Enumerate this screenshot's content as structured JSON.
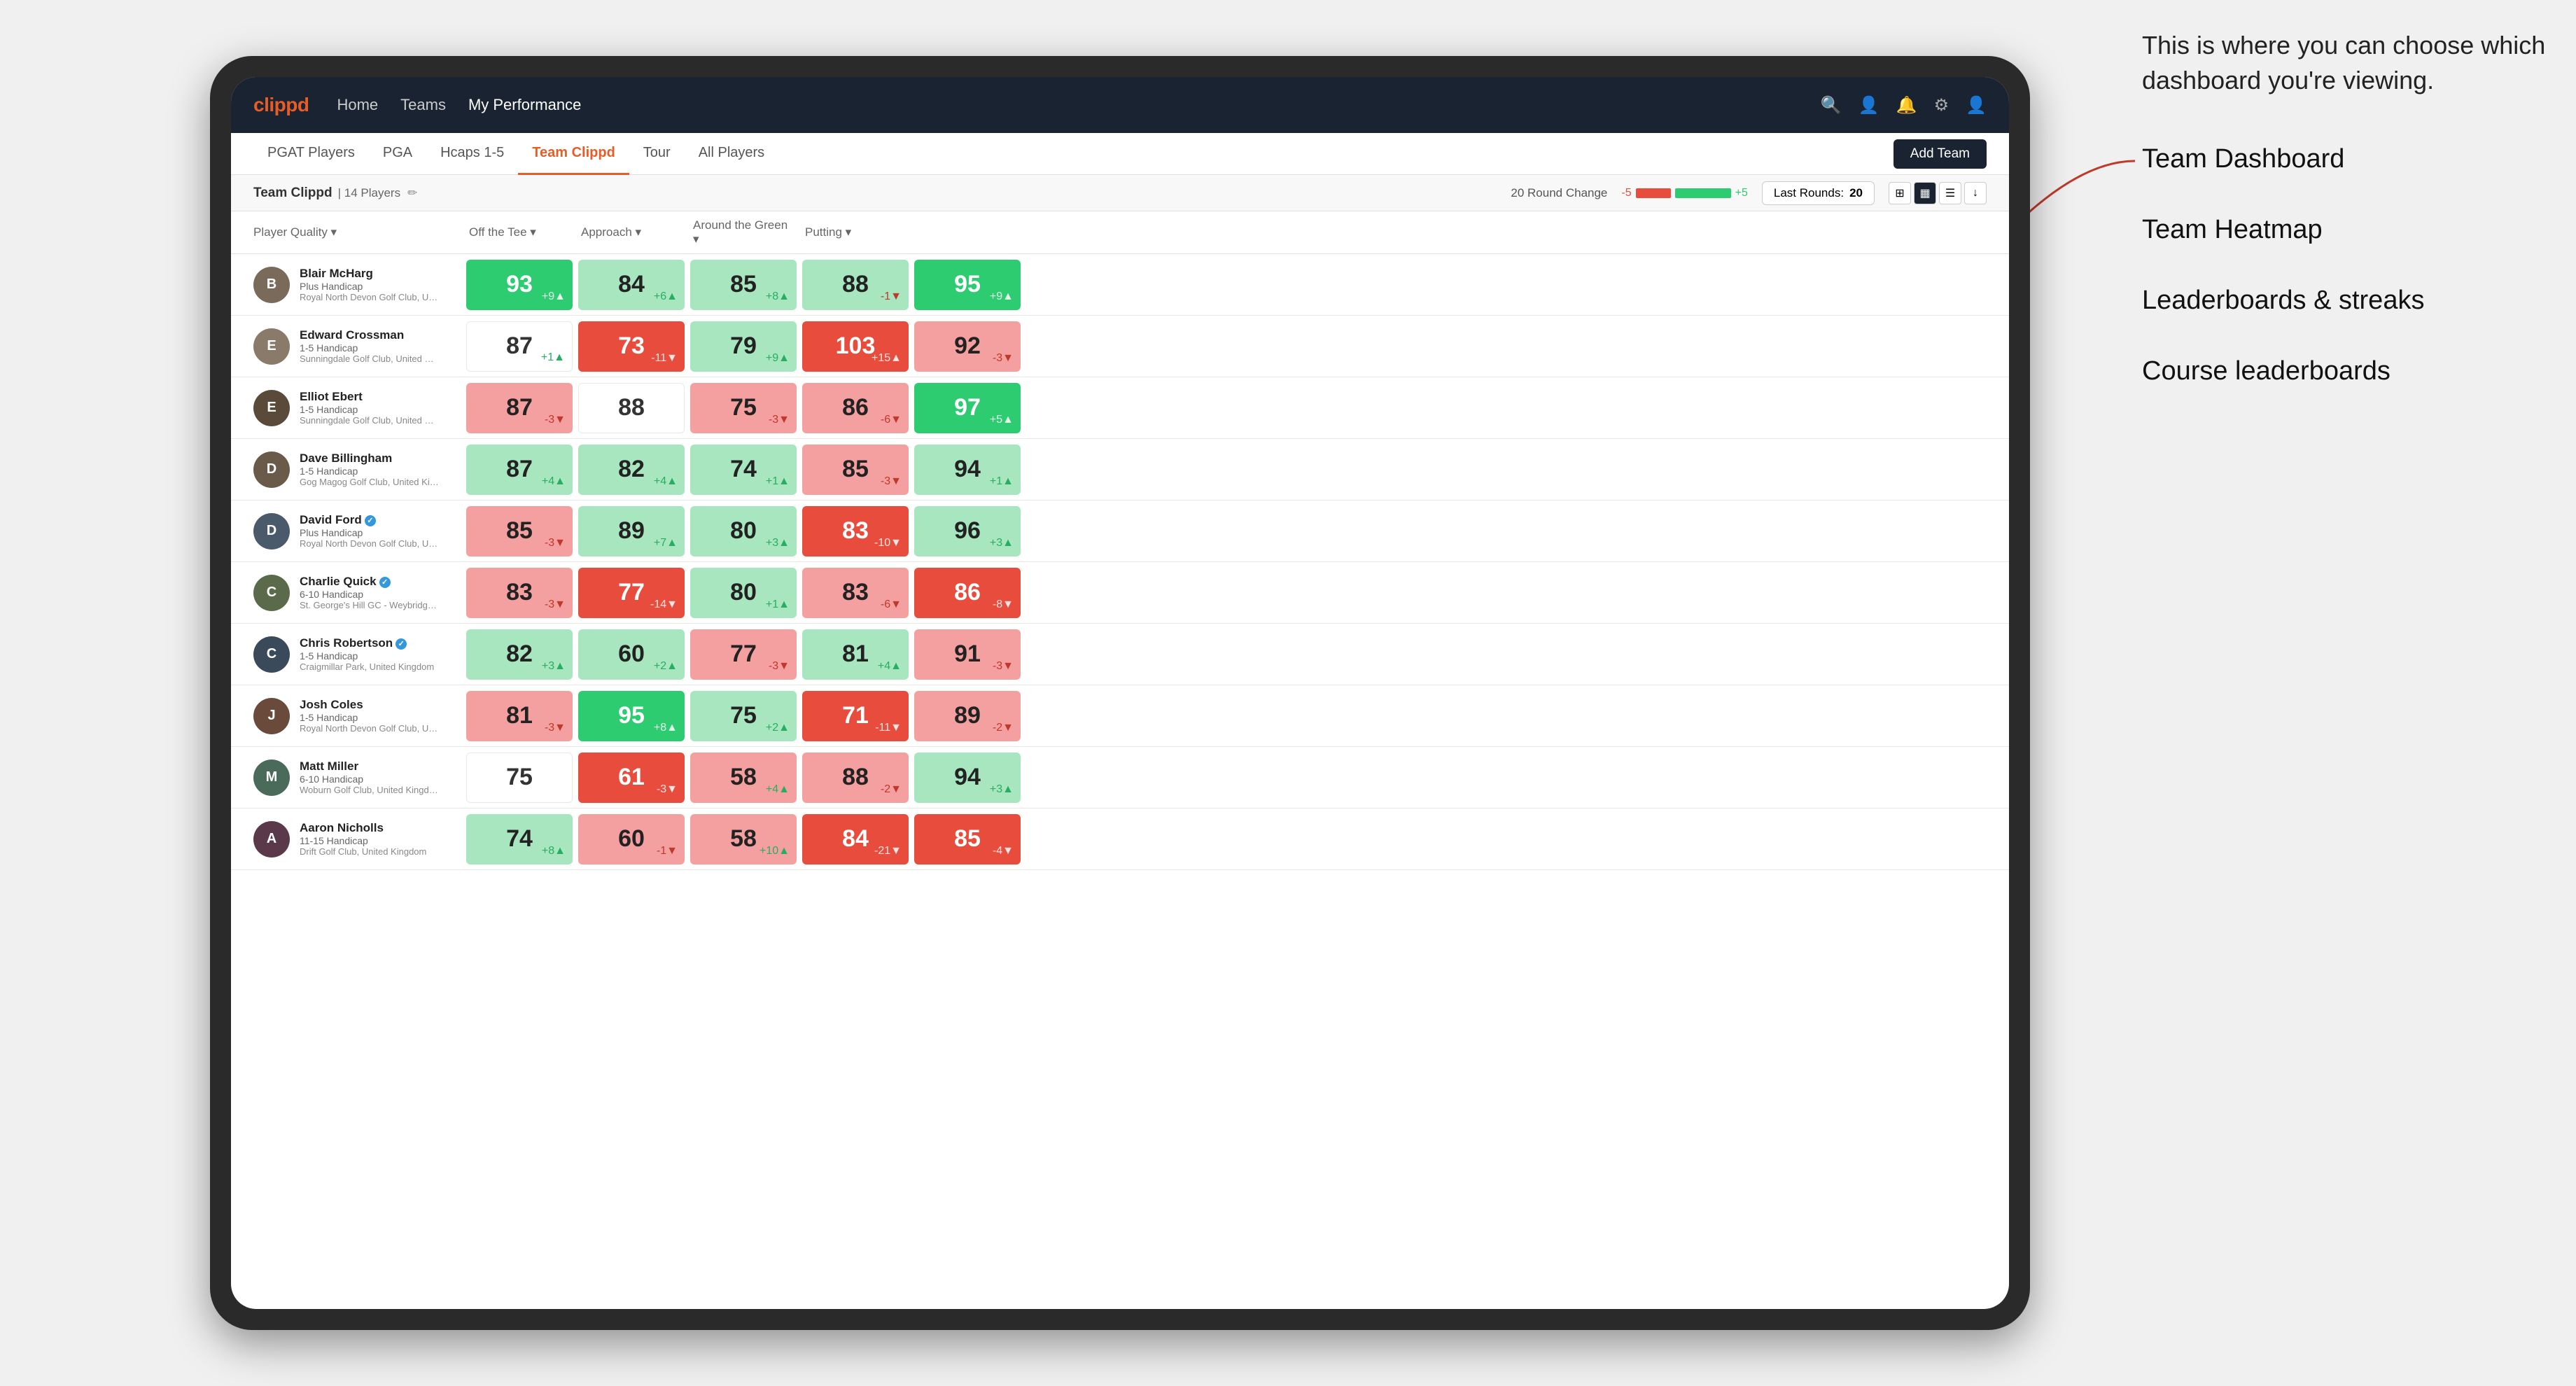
{
  "annotation": {
    "intro": "This is where you can choose which dashboard you're viewing.",
    "items": [
      "Team Dashboard",
      "Team Heatmap",
      "Leaderboards & streaks",
      "Course leaderboards"
    ]
  },
  "nav": {
    "logo": "clippd",
    "items": [
      "Home",
      "Teams",
      "My Performance"
    ],
    "active": "My Performance",
    "icons": [
      "🔍",
      "👤",
      "🔔",
      "⚙",
      "👤"
    ]
  },
  "sub_nav": {
    "items": [
      "PGAT Players",
      "PGA",
      "Hcaps 1-5",
      "Team Clippd",
      "Tour",
      "All Players"
    ],
    "active": "Team Clippd",
    "add_team_label": "Add Team"
  },
  "team_header": {
    "name": "Team Clippd",
    "separator": "|",
    "count": "14 Players",
    "round_change_label": "20 Round Change",
    "bar_neg": "-5",
    "bar_pos": "+5",
    "last_rounds_label": "Last Rounds:",
    "last_rounds_value": "20"
  },
  "columns": {
    "player_quality": "Player Quality ▾",
    "off_tee": "Off the Tee ▾",
    "approach": "Approach ▾",
    "around_green": "Around the Green ▾",
    "putting": "Putting ▾"
  },
  "players": [
    {
      "name": "Blair McHarg",
      "handicap": "Plus Handicap",
      "club": "Royal North Devon Golf Club, United Kingdom",
      "avatar_color": "#7a6a5a",
      "avatar_letter": "B",
      "scores": {
        "quality": {
          "value": 93,
          "change": "+9",
          "direction": "up",
          "color": "green-dark"
        },
        "off_tee": {
          "value": 84,
          "change": "+6",
          "direction": "up",
          "color": "green-light"
        },
        "approach": {
          "value": 85,
          "change": "+8",
          "direction": "up",
          "color": "green-light"
        },
        "around_green": {
          "value": 88,
          "change": "-1",
          "direction": "down",
          "color": "green-light"
        },
        "putting": {
          "value": 95,
          "change": "+9",
          "direction": "up",
          "color": "green-dark"
        }
      }
    },
    {
      "name": "Edward Crossman",
      "handicap": "1-5 Handicap",
      "club": "Sunningdale Golf Club, United Kingdom",
      "avatar_color": "#8a7a6a",
      "avatar_letter": "E",
      "scores": {
        "quality": {
          "value": 87,
          "change": "+1",
          "direction": "up",
          "color": "white"
        },
        "off_tee": {
          "value": 73,
          "change": "-11",
          "direction": "down",
          "color": "red-dark"
        },
        "approach": {
          "value": 79,
          "change": "+9",
          "direction": "up",
          "color": "green-light"
        },
        "around_green": {
          "value": 103,
          "change": "+15",
          "direction": "up",
          "color": "red-dark"
        },
        "putting": {
          "value": 92,
          "change": "-3",
          "direction": "down",
          "color": "red-light"
        }
      }
    },
    {
      "name": "Elliot Ebert",
      "handicap": "1-5 Handicap",
      "club": "Sunningdale Golf Club, United Kingdom",
      "avatar_color": "#5a4a3a",
      "avatar_letter": "E",
      "scores": {
        "quality": {
          "value": 87,
          "change": "-3",
          "direction": "down",
          "color": "red-light"
        },
        "off_tee": {
          "value": 88,
          "change": "",
          "direction": "neutral",
          "color": "white"
        },
        "approach": {
          "value": 75,
          "change": "-3",
          "direction": "down",
          "color": "red-light"
        },
        "around_green": {
          "value": 86,
          "change": "-6",
          "direction": "down",
          "color": "red-light"
        },
        "putting": {
          "value": 97,
          "change": "+5",
          "direction": "up",
          "color": "green-dark"
        }
      }
    },
    {
      "name": "Dave Billingham",
      "handicap": "1-5 Handicap",
      "club": "Gog Magog Golf Club, United Kingdom",
      "avatar_color": "#6a5a4a",
      "avatar_letter": "D",
      "scores": {
        "quality": {
          "value": 87,
          "change": "+4",
          "direction": "up",
          "color": "green-light"
        },
        "off_tee": {
          "value": 82,
          "change": "+4",
          "direction": "up",
          "color": "green-light"
        },
        "approach": {
          "value": 74,
          "change": "+1",
          "direction": "up",
          "color": "green-light"
        },
        "around_green": {
          "value": 85,
          "change": "-3",
          "direction": "down",
          "color": "red-light"
        },
        "putting": {
          "value": 94,
          "change": "+1",
          "direction": "up",
          "color": "green-light"
        }
      }
    },
    {
      "name": "David Ford",
      "handicap": "Plus Handicap",
      "club": "Royal North Devon Golf Club, United Kingdom",
      "avatar_color": "#4a5a6a",
      "avatar_letter": "D",
      "verified": true,
      "scores": {
        "quality": {
          "value": 85,
          "change": "-3",
          "direction": "down",
          "color": "red-light"
        },
        "off_tee": {
          "value": 89,
          "change": "+7",
          "direction": "up",
          "color": "green-light"
        },
        "approach": {
          "value": 80,
          "change": "+3",
          "direction": "up",
          "color": "green-light"
        },
        "around_green": {
          "value": 83,
          "change": "-10",
          "direction": "down",
          "color": "red-dark"
        },
        "putting": {
          "value": 96,
          "change": "+3",
          "direction": "up",
          "color": "green-light"
        }
      }
    },
    {
      "name": "Charlie Quick",
      "handicap": "6-10 Handicap",
      "club": "St. George's Hill GC - Weybridge - Surrey, Uni...",
      "avatar_color": "#5a6a4a",
      "avatar_letter": "C",
      "verified": true,
      "scores": {
        "quality": {
          "value": 83,
          "change": "-3",
          "direction": "down",
          "color": "red-light"
        },
        "off_tee": {
          "value": 77,
          "change": "-14",
          "direction": "down",
          "color": "red-dark"
        },
        "approach": {
          "value": 80,
          "change": "+1",
          "direction": "up",
          "color": "green-light"
        },
        "around_green": {
          "value": 83,
          "change": "-6",
          "direction": "down",
          "color": "red-light"
        },
        "putting": {
          "value": 86,
          "change": "-8",
          "direction": "down",
          "color": "red-dark"
        }
      }
    },
    {
      "name": "Chris Robertson",
      "handicap": "1-5 Handicap",
      "club": "Craigmillar Park, United Kingdom",
      "avatar_color": "#3a4a5a",
      "avatar_letter": "C",
      "verified": true,
      "scores": {
        "quality": {
          "value": 82,
          "change": "+3",
          "direction": "up",
          "color": "green-light"
        },
        "off_tee": {
          "value": 60,
          "change": "+2",
          "direction": "up",
          "color": "green-light"
        },
        "approach": {
          "value": 77,
          "change": "-3",
          "direction": "down",
          "color": "red-light"
        },
        "around_green": {
          "value": 81,
          "change": "+4",
          "direction": "up",
          "color": "green-light"
        },
        "putting": {
          "value": 91,
          "change": "-3",
          "direction": "down",
          "color": "red-light"
        }
      }
    },
    {
      "name": "Josh Coles",
      "handicap": "1-5 Handicap",
      "club": "Royal North Devon Golf Club, United Kingdom",
      "avatar_color": "#6a4a3a",
      "avatar_letter": "J",
      "scores": {
        "quality": {
          "value": 81,
          "change": "-3",
          "direction": "down",
          "color": "red-light"
        },
        "off_tee": {
          "value": 95,
          "change": "+8",
          "direction": "up",
          "color": "green-dark"
        },
        "approach": {
          "value": 75,
          "change": "+2",
          "direction": "up",
          "color": "green-light"
        },
        "around_green": {
          "value": 71,
          "change": "-11",
          "direction": "down",
          "color": "red-dark"
        },
        "putting": {
          "value": 89,
          "change": "-2",
          "direction": "down",
          "color": "red-light"
        }
      }
    },
    {
      "name": "Matt Miller",
      "handicap": "6-10 Handicap",
      "club": "Woburn Golf Club, United Kingdom",
      "avatar_color": "#4a6a5a",
      "avatar_letter": "M",
      "scores": {
        "quality": {
          "value": 75,
          "change": "",
          "direction": "neutral",
          "color": "white"
        },
        "off_tee": {
          "value": 61,
          "change": "-3",
          "direction": "down",
          "color": "red-dark"
        },
        "approach": {
          "value": 58,
          "change": "+4",
          "direction": "up",
          "color": "red-light"
        },
        "around_green": {
          "value": 88,
          "change": "-2",
          "direction": "down",
          "color": "red-light"
        },
        "putting": {
          "value": 94,
          "change": "+3",
          "direction": "up",
          "color": "green-light"
        }
      }
    },
    {
      "name": "Aaron Nicholls",
      "handicap": "11-15 Handicap",
      "club": "Drift Golf Club, United Kingdom",
      "avatar_color": "#5a3a4a",
      "avatar_letter": "A",
      "scores": {
        "quality": {
          "value": 74,
          "change": "+8",
          "direction": "up",
          "color": "green-light"
        },
        "off_tee": {
          "value": 60,
          "change": "-1",
          "direction": "down",
          "color": "red-light"
        },
        "approach": {
          "value": 58,
          "change": "+10",
          "direction": "up",
          "color": "red-light"
        },
        "around_green": {
          "value": 84,
          "change": "-21",
          "direction": "down",
          "color": "red-dark"
        },
        "putting": {
          "value": 85,
          "change": "-4",
          "direction": "down",
          "color": "red-dark"
        }
      }
    }
  ]
}
